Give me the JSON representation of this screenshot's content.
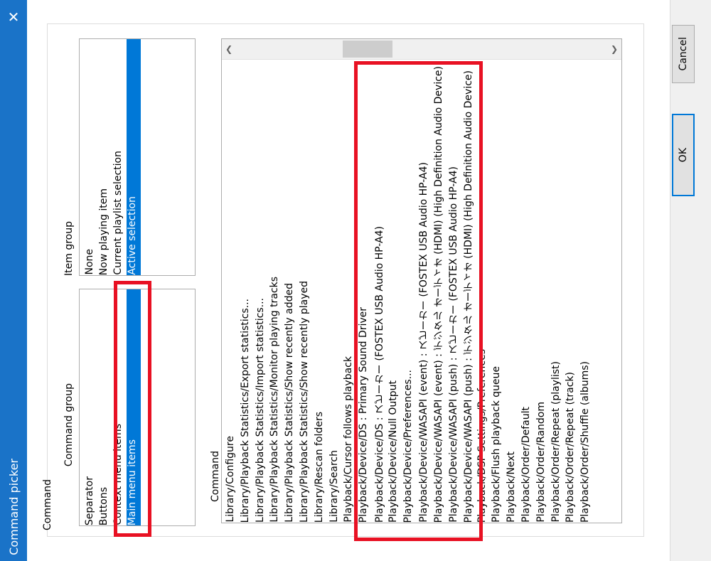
{
  "window": {
    "title": "Command picker"
  },
  "buttons": {
    "ok": "OK",
    "cancel": "Cancel"
  },
  "labels": {
    "section": "Command",
    "command_group": "Command group",
    "item_group": "Item group",
    "command_list": "Command"
  },
  "command_group": {
    "items": [
      "Separator",
      "Buttons",
      "Context menu items",
      "Main menu items"
    ],
    "selected": "Main menu items"
  },
  "item_group": {
    "items": [
      "None",
      "Now playing item",
      "Current playlist selection",
      "Active selection"
    ],
    "selected": "Active selection"
  },
  "commands": [
    "Library/Configure",
    "Library/Playback Statistics/Export statistics...",
    "Library/Playback Statistics/Import statistics...",
    "Library/Playback Statistics/Monitor playing tracks",
    "Library/Playback Statistics/Show recently added",
    "Library/Playback Statistics/Show recently played",
    "Library/Rescan folders",
    "Library/Search",
    "Playback/Cursor follows playback",
    "Playback/Device/DS : Primary Sound Driver",
    "Playback/Device/DS : スピーカー (FOSTEX USB Audio HP-A4)",
    "Playback/Device/Null Output",
    "Playback/Device/Preferences...",
    "Playback/Device/WASAPI (event) : スピーカー (FOSTEX USB Audio HP-A4)",
    "Playback/Device/WASAPI (event) : デジタル オーディオ (HDMI) (High Definition Audio Device)",
    "Playback/Device/WASAPI (push) : スピーカー (FOSTEX USB Audio HP-A4)",
    "Playback/Device/WASAPI (push) : デジタル オーディオ (HDMI) (High Definition Audio Device)",
    "Playback/DSP Settings/Preferences",
    "Playback/Flush playback queue",
    "Playback/Next",
    "Playback/Order/Default",
    "Playback/Order/Random",
    "Playback/Order/Repeat (playlist)",
    "Playback/Order/Repeat (track)",
    "Playback/Order/Shuffle (albums)"
  ],
  "icons": {
    "close": "close-icon",
    "scroll_left": "chevron-left-icon",
    "scroll_right": "chevron-right-icon"
  },
  "colors": {
    "titlebar": "#1a73c8",
    "selection": "#0078d7",
    "highlight_box": "#e81123"
  }
}
